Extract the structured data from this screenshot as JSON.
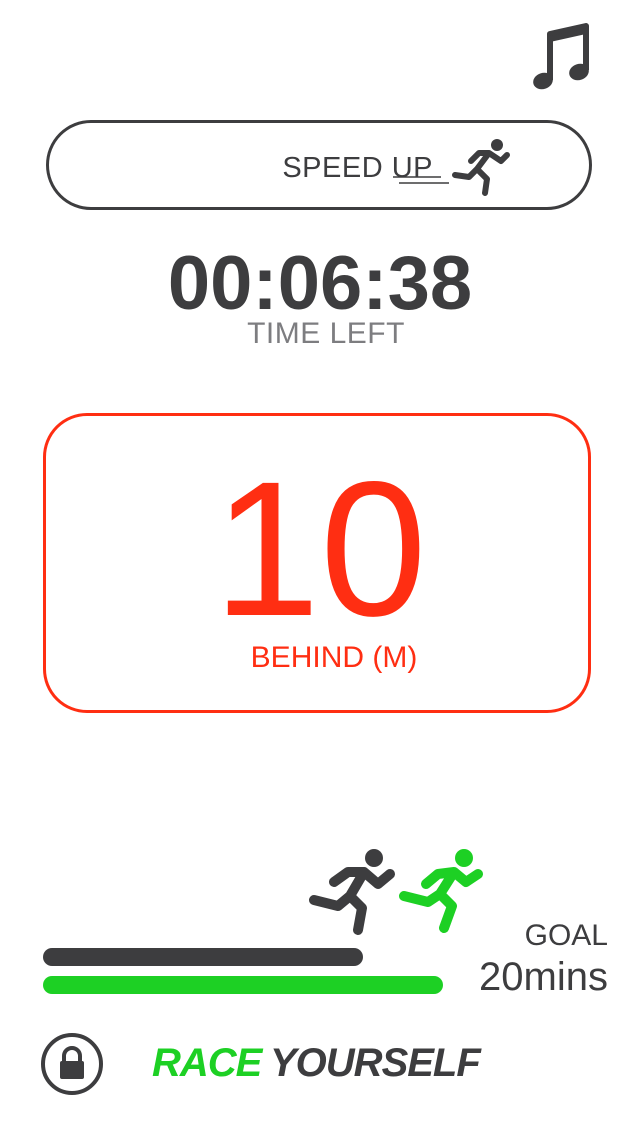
{
  "status": {
    "hint_text": "SPEED UP",
    "timer_value": "00:06:38",
    "timer_label": "TIME LEFT",
    "behind_value": "10",
    "behind_label": "BEHIND (M)"
  },
  "progress": {
    "runner_fraction": 0.8,
    "goal_label": "GOAL",
    "goal_value": "20mins"
  },
  "brand": {
    "logo_text_green": "RACE",
    "logo_text_dark": "YOURSELF"
  },
  "icons": {
    "music": "music-note-icon",
    "lock": "lock-icon",
    "runner_player": "runner-icon",
    "runner_target": "runner-icon",
    "speed": "running-fast-icon"
  },
  "colors": {
    "dark": "#3d3d3f",
    "accent_red": "#ff2e12",
    "accent_green": "#1dd024",
    "muted": "#7d7d80"
  }
}
